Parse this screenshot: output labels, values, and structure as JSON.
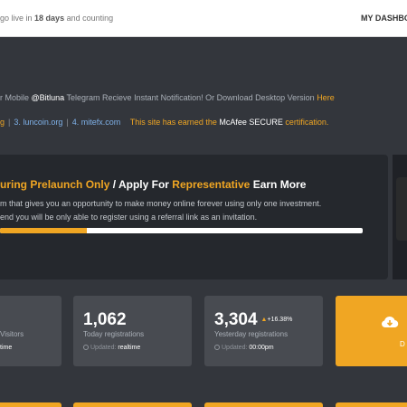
{
  "topbar": {
    "countdown_prefix": "go live in",
    "countdown_value": "18 days",
    "countdown_suffix": "and counting",
    "dashboard_link": "MY DASHBO"
  },
  "notice": {
    "prefix": "r Mobile",
    "handle": "@Bitluna",
    "middle": "Telegram Recieve Instant Notification! Or Download Desktop Version",
    "link": "Here"
  },
  "sites": {
    "first": "g",
    "second": "3. luncoin.org",
    "third": "4. mitefx.com",
    "mcafee_prefix": "This site has earned the",
    "mcafee_brand": "McAfee SECURE",
    "mcafee_suffix": "certification."
  },
  "promo": {
    "title_1": "uring",
    "title_2": "Prelaunch Only",
    "title_3": "/ Apply For",
    "title_4": "Representative",
    "title_5": "Earn More",
    "line_1": "m that gives you an opportunity to make money online forever using only one investment.",
    "line_2": "end you will be only able to register using a referral link as an invitation.",
    "progress_fraction": 0.24
  },
  "stats": [
    {
      "label": "Visitors",
      "updated_value": "time"
    },
    {
      "number": "1,062",
      "label": "Today registrations",
      "updated_prefix": "Updated:",
      "updated_value": "realtime"
    },
    {
      "number": "3,304",
      "change": "+16.38%",
      "label": "Yesterday registrations",
      "updated_prefix": "Updated:",
      "updated_value": "00:00pm"
    }
  ],
  "download": {
    "icon": "cloud-download-icon",
    "label": "D"
  },
  "colors": {
    "accent": "#f0a623",
    "panel": "#484b51",
    "background": "#33363c"
  }
}
